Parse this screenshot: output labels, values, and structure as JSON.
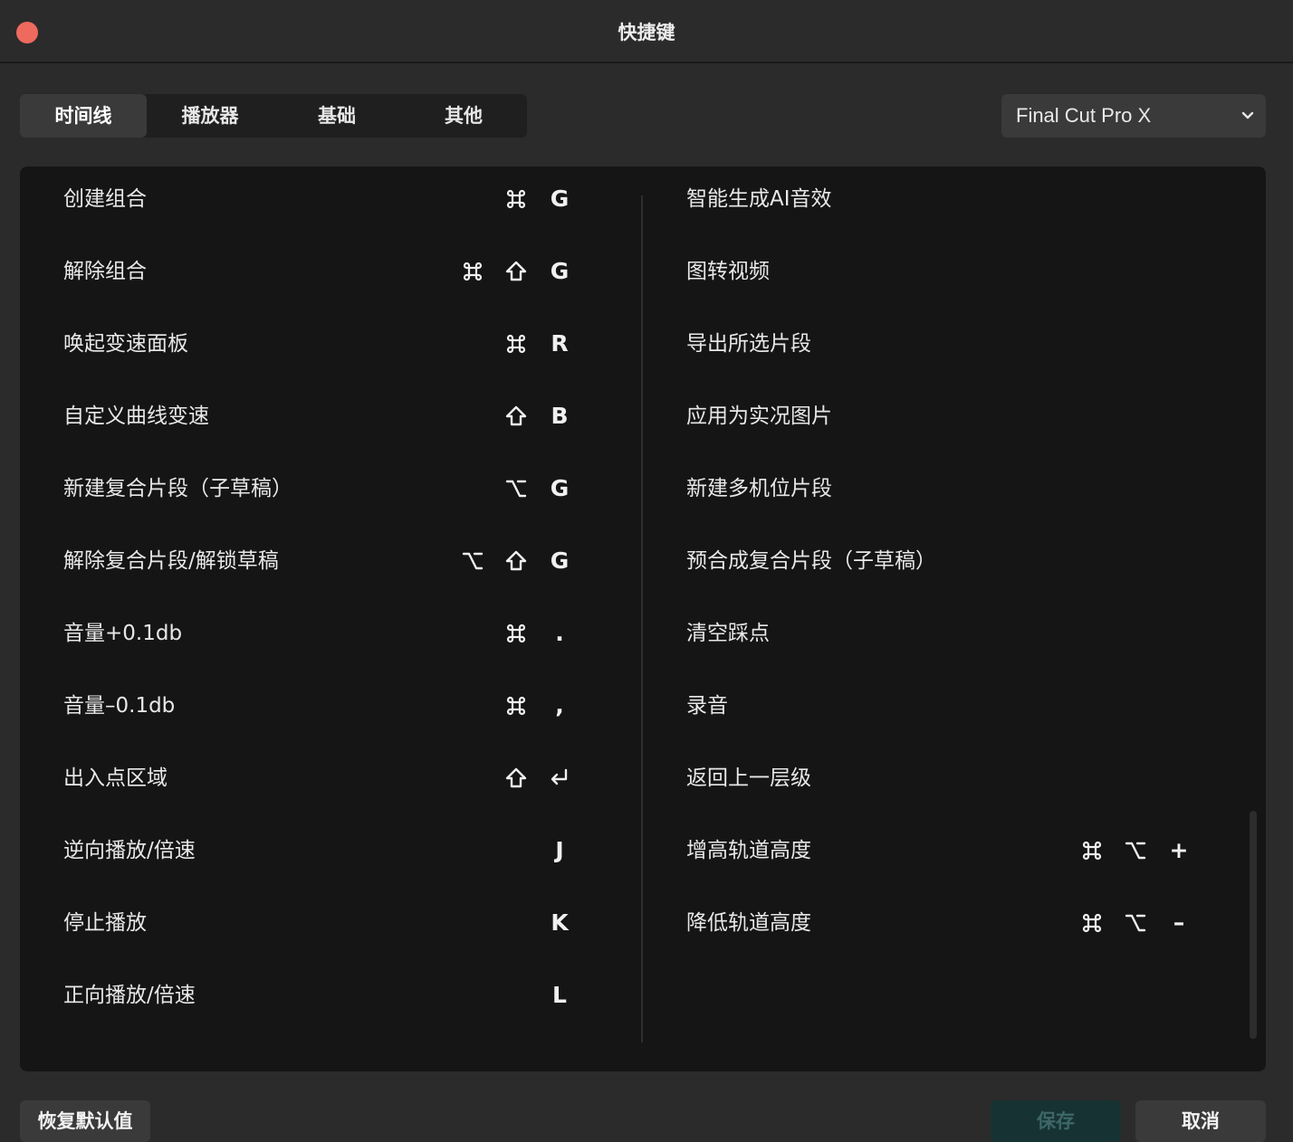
{
  "window": {
    "title": "快捷键"
  },
  "tabs": [
    {
      "label": "时间线",
      "active": true
    },
    {
      "label": "播放器",
      "active": false
    },
    {
      "label": "基础",
      "active": false
    },
    {
      "label": "其他",
      "active": false
    }
  ],
  "preset": {
    "value": "Final Cut Pro X"
  },
  "left_column": [
    {
      "label": "创建组合",
      "keys": [
        "cmd-icon",
        "G"
      ]
    },
    {
      "label": "解除组合",
      "keys": [
        "cmd-icon",
        "shift-icon",
        "G"
      ]
    },
    {
      "label": "唤起变速面板",
      "keys": [
        "cmd-icon",
        "R"
      ]
    },
    {
      "label": "自定义曲线变速",
      "keys": [
        "shift-icon",
        "B"
      ]
    },
    {
      "label": "新建复合片段（子草稿）",
      "keys": [
        "option-icon",
        "G"
      ]
    },
    {
      "label": "解除复合片段/解锁草稿",
      "keys": [
        "option-icon",
        "shift-icon",
        "G"
      ]
    },
    {
      "label": "音量+0.1db",
      "keys": [
        "cmd-icon",
        "."
      ]
    },
    {
      "label": "音量–0.1db",
      "keys": [
        "cmd-icon",
        ","
      ]
    },
    {
      "label": "出入点区域",
      "keys": [
        "shift-icon",
        "return-icon"
      ]
    },
    {
      "label": "逆向播放/倍速",
      "keys": [
        "J"
      ]
    },
    {
      "label": "停止播放",
      "keys": [
        "K"
      ]
    },
    {
      "label": "正向播放/倍速",
      "keys": [
        "L"
      ]
    }
  ],
  "right_column": [
    {
      "label": "智能生成AI音效",
      "keys": []
    },
    {
      "label": "图转视频",
      "keys": []
    },
    {
      "label": "导出所选片段",
      "keys": []
    },
    {
      "label": "应用为实况图片",
      "keys": []
    },
    {
      "label": "新建多机位片段",
      "keys": []
    },
    {
      "label": "预合成复合片段（子草稿）",
      "keys": []
    },
    {
      "label": "清空踩点",
      "keys": []
    },
    {
      "label": "录音",
      "keys": []
    },
    {
      "label": "返回上一层级",
      "keys": []
    },
    {
      "label": "增高轨道高度",
      "keys": [
        "cmd-icon",
        "option-icon",
        "+"
      ]
    },
    {
      "label": "降低轨道高度",
      "keys": [
        "cmd-icon",
        "option-icon",
        "–"
      ]
    }
  ],
  "footer": {
    "restore_label": "恢复默认值",
    "save_label": "保存",
    "cancel_label": "取消"
  },
  "colors": {
    "close_button": "#ee6a5e",
    "save_button_bg": "#173233",
    "save_button_text": "#3d6768"
  }
}
